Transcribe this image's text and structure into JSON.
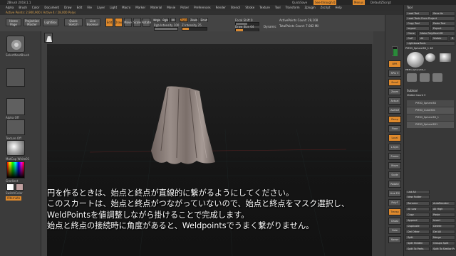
{
  "titlebar": {
    "title": "ZBrush 2018.1.1",
    "right_quicksave": "QuickSave",
    "right_seethrough": "See-through 0",
    "right_menus": "Menus",
    "right_script": "DefaultZScript"
  },
  "menu": [
    "Alpha",
    "Brush",
    "Color",
    "Document",
    "Draw",
    "Edit",
    "File",
    "Layer",
    "Light",
    "Macro",
    "Marker",
    "Material",
    "Movie",
    "Picker",
    "Preferences",
    "Render",
    "Stencil",
    "Stroke",
    "Texture",
    "Tool",
    "Transform",
    "Zplugin",
    "Zscript",
    "Help"
  ],
  "notice": "Active Points: 2,900,900 / Active 4 / 28,000 Polys",
  "toolbar": {
    "home": "Home Page",
    "projection": "Projection Master",
    "lightbox": "LightBox",
    "quicksketch": "Quick Sketch",
    "liveboolean": "Live Boolean",
    "edit": "Edit",
    "draw": "Draw",
    "move": "Move",
    "scale": "Scale",
    "rotate": "Rotate",
    "mrgb": "Mrgb",
    "rgb": "Rgb",
    "m": "M",
    "zadd": "Zadd",
    "zsub": "Zsub",
    "zcut": "Zcut",
    "rgb_intensity": "Rgb Intensity 100",
    "z_intensity": "Z Intensity 25",
    "focal_shift": "Focal Shift 0",
    "draw_size": "Draw Size 64",
    "dynamic": "Dynamic",
    "active_points": "ActivePoints Count: 28,108",
    "total_points": "TotalPoints Count: 7.082 Mil"
  },
  "left": {
    "brush_label": "SelectNextBrush",
    "alpha_label": "Alpha Off",
    "texture_label": "Texture Off",
    "material_label": "MatCap White01",
    "gradient": "Gradient",
    "switch": "SwitchColor",
    "alternate": "Alternate"
  },
  "tool_panel": {
    "title": "Tool",
    "load": "Load Tool",
    "save_as": "Save As",
    "load_from_project": "Load Tools From Project",
    "copy": "Copy Tool",
    "paste": "Paste Tool",
    "import": "Import",
    "export": "Export",
    "clone": "Clone",
    "make_polymesh": "Make PolyMesh3D",
    "goz": "GoZ",
    "all": "All",
    "visible": "Visible",
    "r": "R",
    "lightbox_tools": "Lightbox▸Tools",
    "current_tool": "PM3D_Sphere3D_1 48",
    "thumbs": [
      "PM3D_Sphere3D_1",
      "Cylinder3D",
      "PolyMesh3D",
      "SimpleBrush",
      "AlphaBrush",
      "EraserBrush"
    ],
    "subtool_head": "Subtool",
    "visible_count": "Visible Count 3",
    "subtools": [
      "PM3D_Sphere3D",
      "PM3D_Cube3D1",
      "PM3D_Sphere3D_1",
      "PM3D_Sphere3D1"
    ],
    "list_all": "List All",
    "new_folder": "New Folder",
    "buttons": [
      "Rename",
      "AutoReorder",
      "All Low",
      "All High",
      "Copy",
      "Paste",
      "Append",
      "Insert",
      "Duplicate",
      "Delete",
      "Del Other",
      "Del All",
      "Split",
      "Merge",
      "Split Hidden",
      "Groups Split",
      "Split To Parts",
      "Split To Similar Parts"
    ]
  },
  "caption": [
    "円を作るときは、始点と終点が直線的に繋がるようにしてください。",
    "このスカートは、始点と終点がつながっていないので、始点と終点をマスク選択し、",
    "WeldPointsを値調整しながら掛けることで完成します。",
    "始点と終点の接続時に角度があると、Weldpointsでうまく繋がりません。"
  ],
  "right_strip": [
    "BPR",
    "SPix 3",
    "Scroll",
    "Zoom",
    "Actual",
    "AAHalf",
    "Persp",
    "Floor",
    "Local",
    "L.Sym",
    "Frame",
    "Move",
    "Scale",
    "Rotate",
    "Line Fill",
    "PolyF",
    "Transp",
    "Ghost",
    "Solo",
    "Xpose"
  ],
  "colors": {
    "accent": "#e08a2c",
    "cloth": "#8a7d78"
  }
}
